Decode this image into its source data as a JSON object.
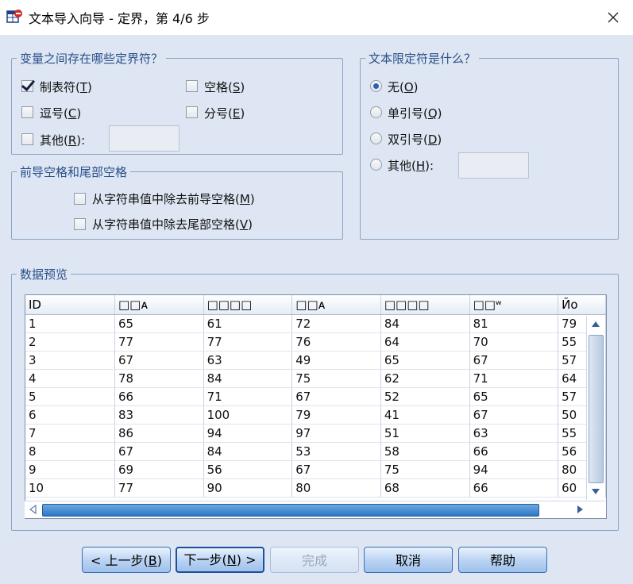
{
  "window": {
    "title": "文本导入向导 - 定界，第 4/6 步",
    "app_icon": "spss-table-icon",
    "close_icon": "close-icon"
  },
  "delimiters": {
    "legend": "变量之间存在哪些定界符？",
    "tab": {
      "text": "制表符(",
      "key": "T",
      "end": ")",
      "checked": true
    },
    "space": {
      "text": "空格(",
      "key": "S",
      "end": ")",
      "checked": false
    },
    "comma": {
      "text": "逗号(",
      "key": "C",
      "end": ")",
      "checked": false
    },
    "semicolon": {
      "text": "分号(",
      "key": "E",
      "end": ")",
      "checked": false
    },
    "other": {
      "text": "其他(",
      "key": "R",
      "end": "):",
      "checked": false,
      "value": ""
    }
  },
  "spaces": {
    "legend": "前导空格和尾部空格",
    "leading": {
      "text": "从字符串值中除去前导空格(",
      "key": "M",
      "end": ")",
      "checked": false
    },
    "trailing": {
      "text": "从字符串值中除去尾部空格(",
      "key": "V",
      "end": ")",
      "checked": false
    }
  },
  "qualifier": {
    "legend": "文本限定符是什么？",
    "none": {
      "text": "无(",
      "key": "O",
      "end": ")",
      "selected": true
    },
    "single": {
      "text": "单引号(",
      "key": "Q",
      "end": ")",
      "selected": false
    },
    "double": {
      "text": "双引号(",
      "key": "D",
      "end": ")",
      "selected": false
    },
    "other": {
      "text": "其他(",
      "key": "H",
      "end": "):",
      "selected": false,
      "value": ""
    }
  },
  "preview": {
    "legend": "数据预览",
    "columns": [
      "ID",
      "□□ᴀ",
      "□□□□",
      "□□ᴀ",
      "□□□□",
      "□□ʷ",
      "Йо"
    ],
    "rows": [
      [
        "1",
        "65",
        "61",
        "72",
        "84",
        "81",
        "79"
      ],
      [
        "2",
        "77",
        "77",
        "76",
        "64",
        "70",
        "55"
      ],
      [
        "3",
        "67",
        "63",
        "49",
        "65",
        "67",
        "57"
      ],
      [
        "4",
        "78",
        "84",
        "75",
        "62",
        "71",
        "64"
      ],
      [
        "5",
        "66",
        "71",
        "67",
        "52",
        "65",
        "57"
      ],
      [
        "6",
        "83",
        "100",
        "79",
        "41",
        "67",
        "50"
      ],
      [
        "7",
        "86",
        "94",
        "97",
        "51",
        "63",
        "55"
      ],
      [
        "8",
        "67",
        "84",
        "53",
        "58",
        "66",
        "56"
      ],
      [
        "9",
        "69",
        "56",
        "67",
        "75",
        "94",
        "80"
      ],
      [
        "10",
        "77",
        "90",
        "80",
        "68",
        "66",
        "60"
      ]
    ]
  },
  "buttons": {
    "back": {
      "text": "< 上一步(",
      "key": "B",
      "end": ")"
    },
    "next": {
      "text": "下一步(",
      "key": "N",
      "end": ") >"
    },
    "finish": "完成",
    "cancel": "取消",
    "help": "帮助"
  },
  "colors": {
    "accent": "#2a4f8a",
    "background": "#dde6f2"
  }
}
